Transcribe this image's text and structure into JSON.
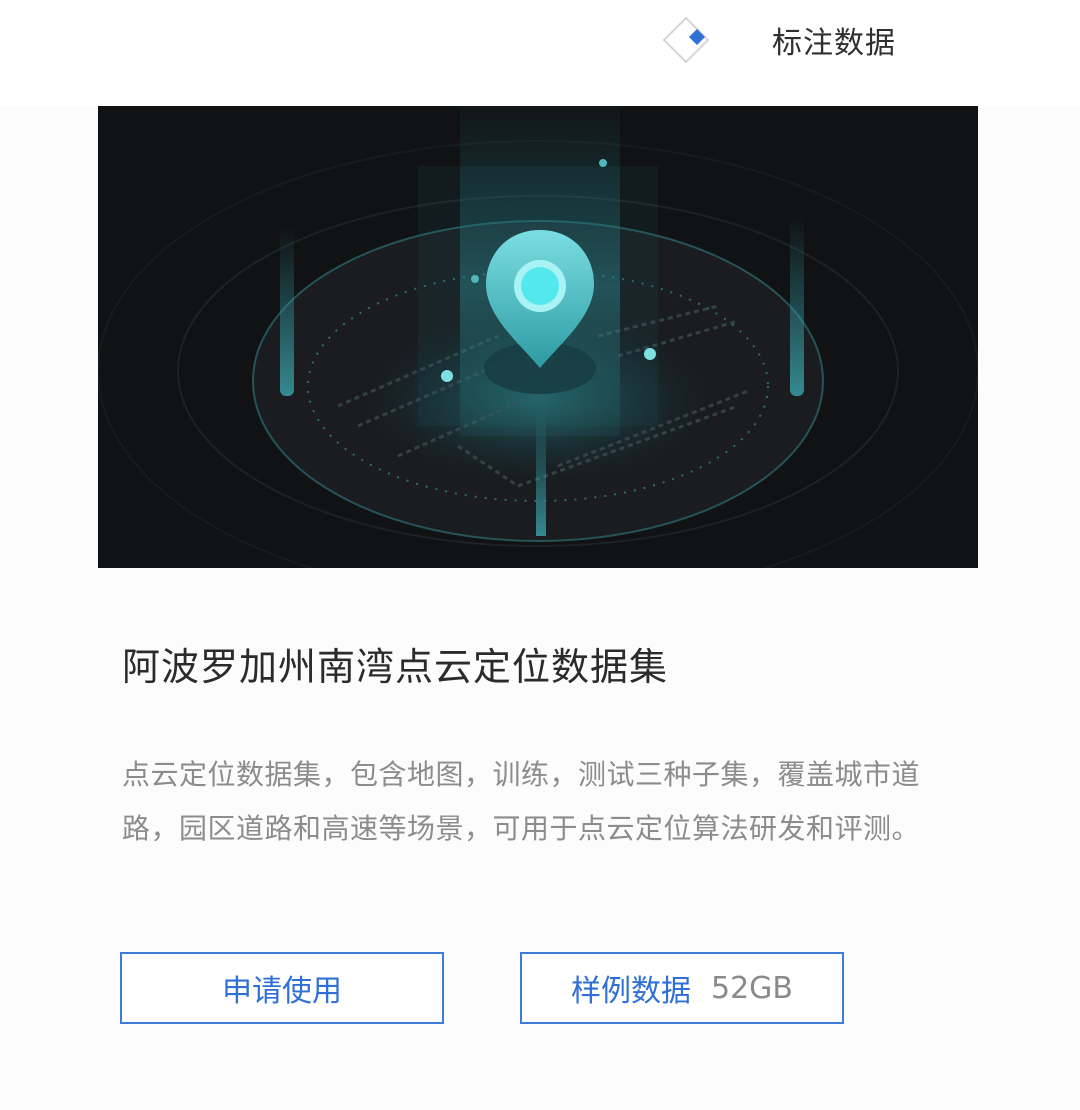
{
  "header": {
    "icon": "diamond-icon",
    "label": "标注数据",
    "accent_color": "#2f6fd6"
  },
  "dataset": {
    "hero_image": "location-pin-illustration",
    "title": "阿波罗加州南湾点云定位数据集",
    "description": "点云定位数据集，包含地图，训练，测试三种子集，覆盖城市道路，园区道路和高速等场景，可用于点云定位算法研发和评测。"
  },
  "actions": {
    "apply_label": "申请使用",
    "sample_label": "样例数据",
    "sample_size": "52GB",
    "border_color": "#3f7bd8"
  }
}
